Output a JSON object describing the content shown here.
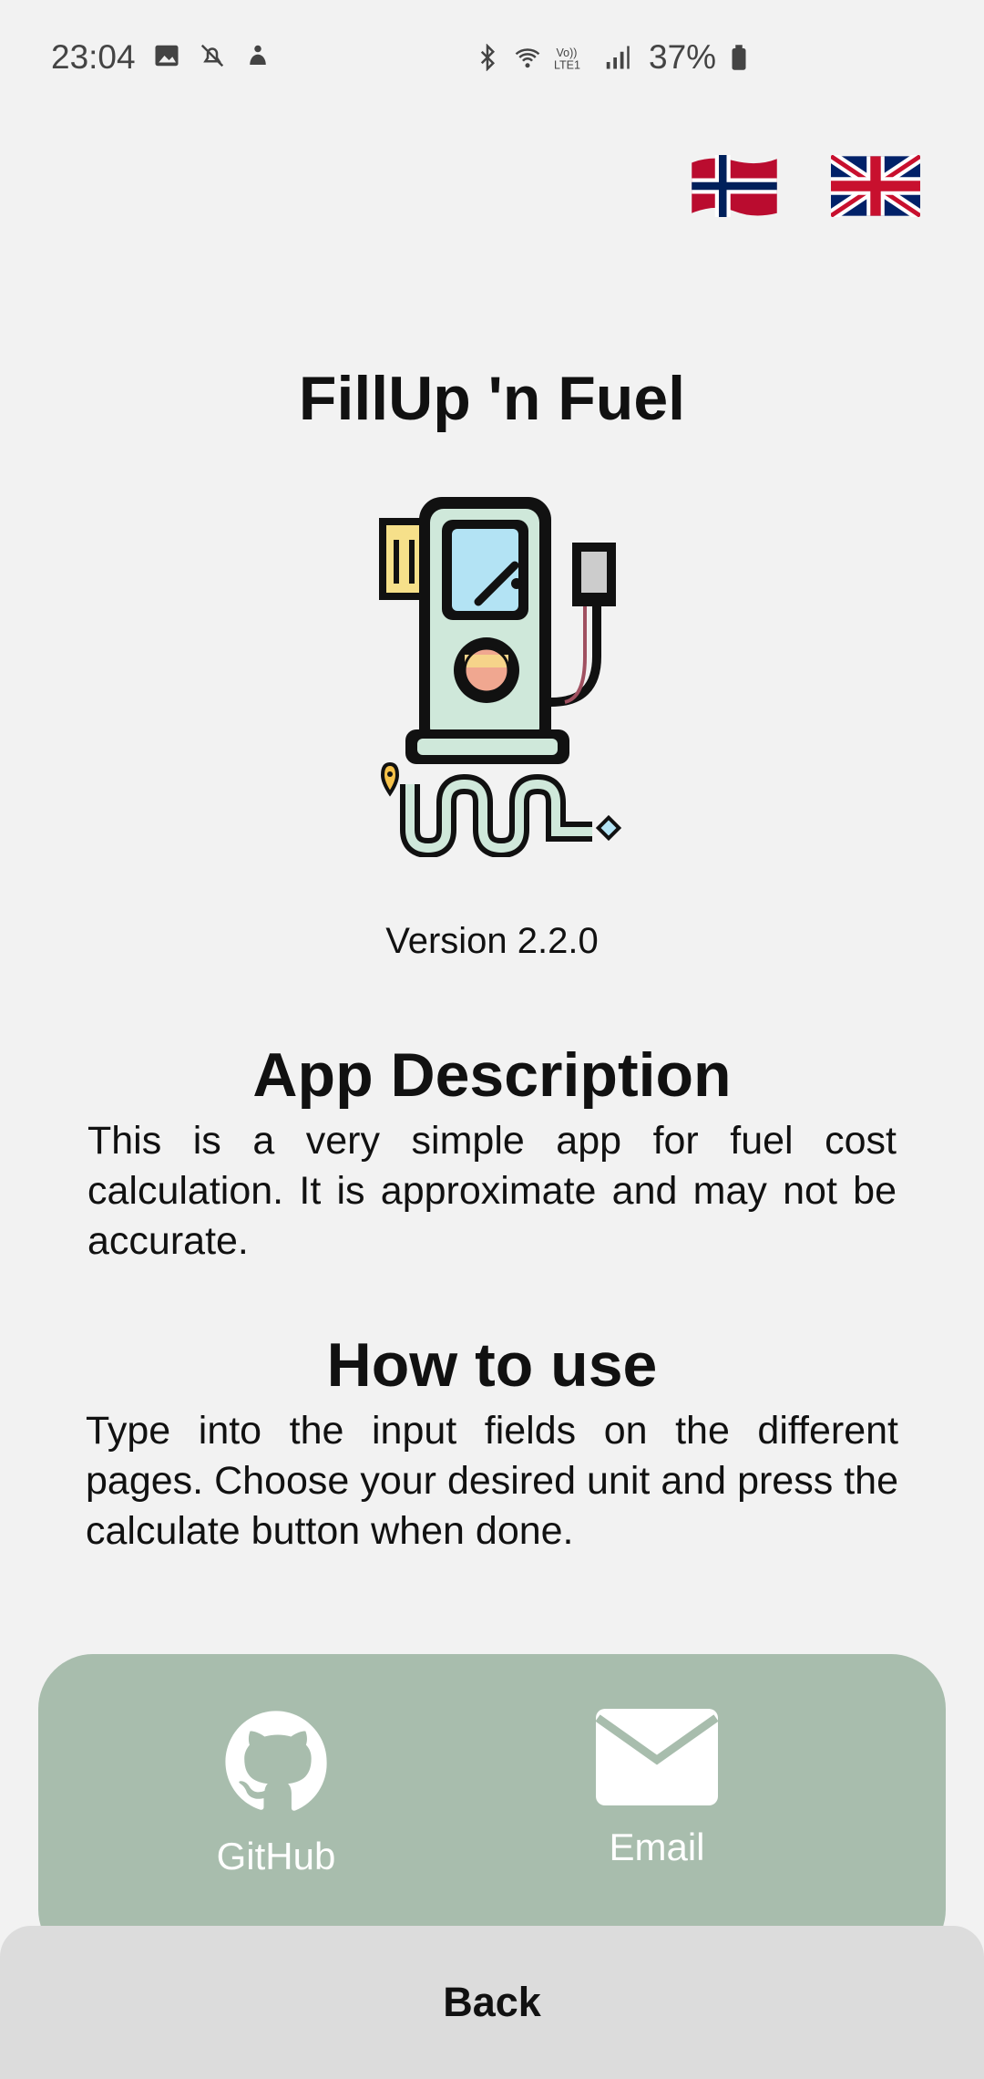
{
  "status_bar": {
    "time": "23:04",
    "battery": "37%",
    "icons": [
      "image-icon",
      "notifications-off-icon",
      "hand-icon",
      "bluetooth-icon",
      "wifi-icon",
      "volte-icon",
      "signal-icon",
      "battery-icon"
    ]
  },
  "languages": [
    {
      "name": "norwegian-flag-icon"
    },
    {
      "name": "uk-flag-icon"
    }
  ],
  "app": {
    "title": "FillUp 'n Fuel",
    "version": "Version 2.2.0"
  },
  "description": {
    "title": "App Description",
    "text": "This is a very simple app for fuel cost calculation. It is approximate and may not be accurate."
  },
  "how_to_use": {
    "title": "How to use",
    "text": "Type into the input fields on the different pages. Choose your desired unit and press the calculate button when done."
  },
  "footer": {
    "github_label": "GitHub",
    "email_label": "Email",
    "card_color": "#a8bdad"
  },
  "back_label": "Back"
}
